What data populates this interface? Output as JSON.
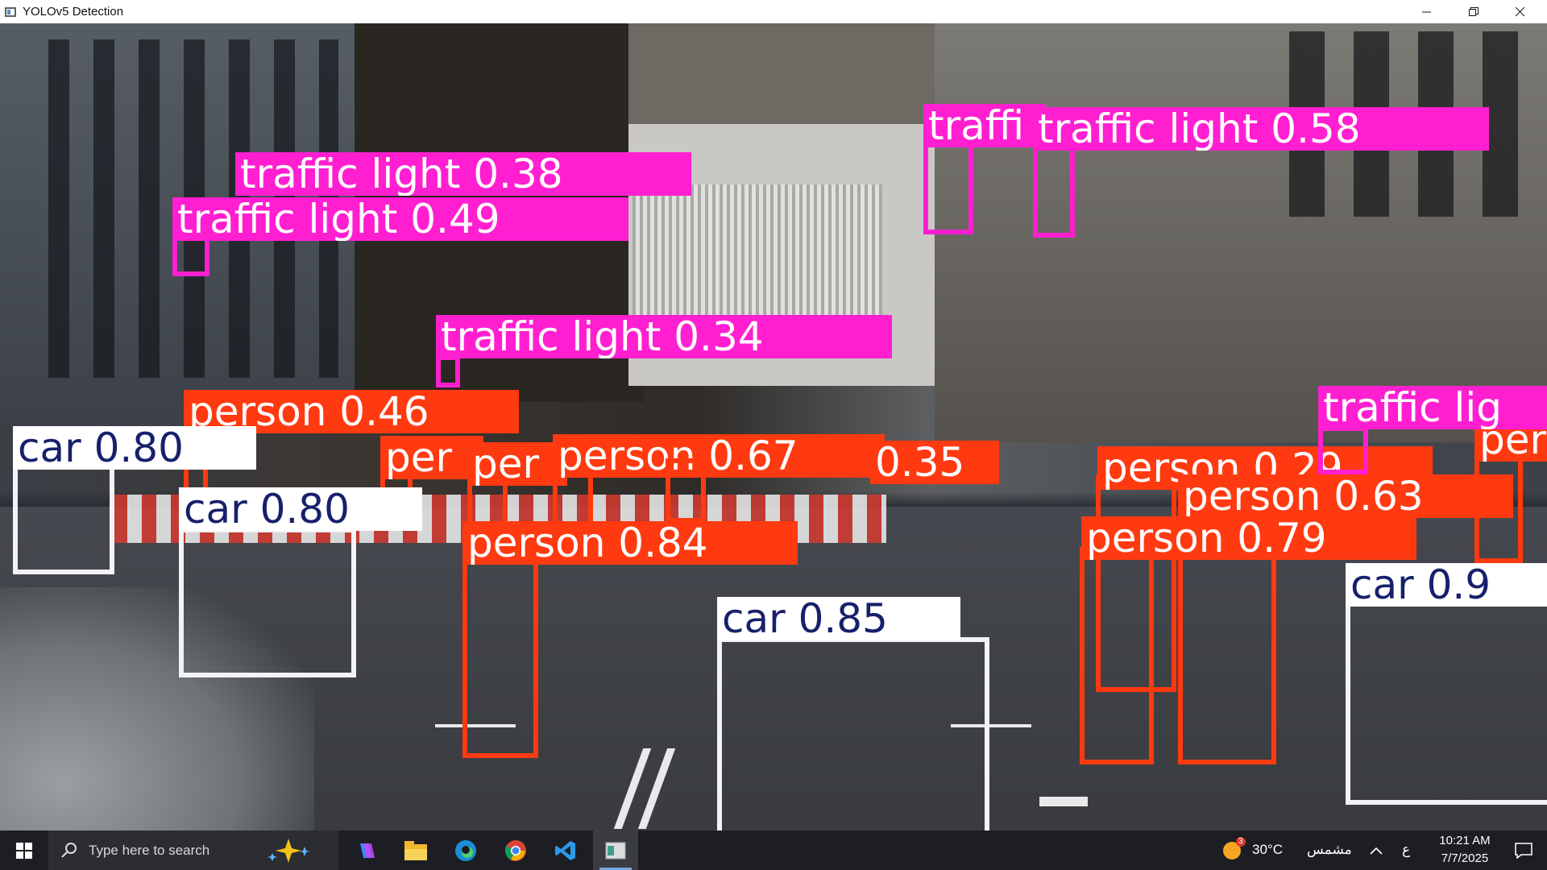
{
  "window": {
    "title": "YOLOv5 Detection",
    "minimize_icon": "minimize-icon",
    "maximize_icon": "restore-icon",
    "close_icon": "close-icon"
  },
  "detections": [
    {
      "cls": "person",
      "label": "person 0.46"
    },
    {
      "cls": "person",
      "label": "per"
    },
    {
      "cls": "person",
      "label": "per"
    },
    {
      "cls": "person",
      "label": "person 0.67"
    },
    {
      "cls": "person",
      "label": "0.35"
    },
    {
      "cls": "person",
      "label": "person 0.84"
    },
    {
      "cls": "person",
      "label": "person 0.29"
    },
    {
      "cls": "person",
      "label": "person 0.63"
    },
    {
      "cls": "person",
      "label": "person 0.79"
    },
    {
      "cls": "person",
      "label": "per"
    },
    {
      "cls": "traffic light",
      "label": "traffic light 0.38"
    },
    {
      "cls": "traffic light",
      "label": "traffic light 0.49"
    },
    {
      "cls": "traffic light",
      "label": "traffic light 0.34"
    },
    {
      "cls": "traffic light",
      "label": "traffi"
    },
    {
      "cls": "traffic light",
      "label": "traffic light 0.58"
    },
    {
      "cls": "traffic light",
      "label": "traffic lig"
    },
    {
      "cls": "car",
      "label": "car 0.80"
    },
    {
      "cls": "car",
      "label": "car 0.80"
    },
    {
      "cls": "car",
      "label": "car 0.85"
    },
    {
      "cls": "car",
      "label": "car 0.9"
    }
  ],
  "colors": {
    "person": "#ff3a10",
    "traffic_light": "#ff1fd1",
    "car": "#ffffff",
    "car_text": "#17206b"
  },
  "taskbar": {
    "start_icon": "windows-logo-icon",
    "search_placeholder": "Type here to search",
    "search_icon": "search-icon",
    "apps": [
      {
        "name": "copilot-icon"
      },
      {
        "name": "file-explorer-icon"
      },
      {
        "name": "edge-icon"
      },
      {
        "name": "chrome-icon"
      },
      {
        "name": "vscode-icon"
      },
      {
        "name": "yolo-window-icon",
        "active": true
      }
    ],
    "weather": {
      "temp": "30°C",
      "condition": "مشمس",
      "badge": "3"
    },
    "language": "ع",
    "time": "10:21 AM",
    "date": "7/7/2025"
  }
}
